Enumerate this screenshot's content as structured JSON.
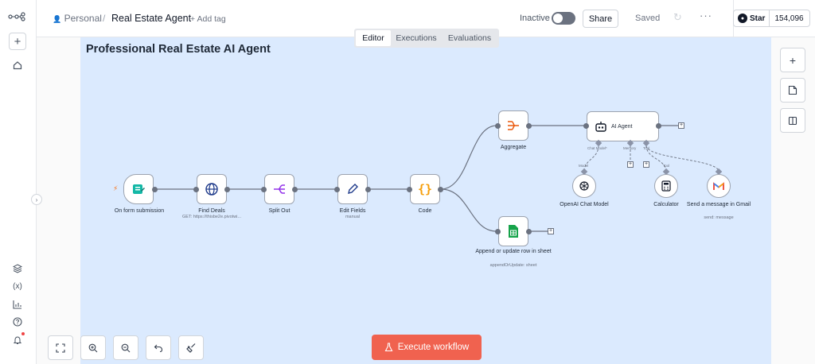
{
  "header": {
    "project": "Personal",
    "separator": "/",
    "workflow_name": "Real Estate Agent",
    "add_tag": "+ Add tag",
    "status": "Inactive",
    "share_label": "Share",
    "saved_label": "Saved",
    "more_label": "···",
    "github_star_label": "Star",
    "github_star_count": "154,096"
  },
  "tabs": [
    {
      "label": "Editor",
      "active": true
    },
    {
      "label": "Executions",
      "active": false
    },
    {
      "label": "Evaluations",
      "active": false
    }
  ],
  "canvas": {
    "title": "Professional Real Estate AI Agent",
    "nodes": [
      {
        "id": "form",
        "label": "On form submission",
        "subtitle": ""
      },
      {
        "id": "find",
        "label": "Find Deals",
        "subtitle": "GET: https://thisbe2e.pivotwi..."
      },
      {
        "id": "split",
        "label": "Split Out",
        "subtitle": ""
      },
      {
        "id": "edit",
        "label": "Edit Fields",
        "subtitle": "manual"
      },
      {
        "id": "code",
        "label": "Code",
        "subtitle": ""
      },
      {
        "id": "aggregate",
        "label": "Aggregate",
        "subtitle": ""
      },
      {
        "id": "sheets",
        "label": "Append or update row in sheet",
        "subtitle": "appendOrUpdate: sheet"
      },
      {
        "id": "agent",
        "label": "AI Agent",
        "subtitle": ""
      },
      {
        "id": "openai",
        "label": "OpenAI Chat Model",
        "subtitle": ""
      },
      {
        "id": "calc",
        "label": "Calculator",
        "subtitle": ""
      },
      {
        "id": "gmail",
        "label": "Send a message in Gmail",
        "subtitle": "send: message"
      }
    ],
    "agent_ports": {
      "chat_model": "Chat Model*",
      "memory": "Memory",
      "tool": "Tool"
    },
    "sub_port_labels": {
      "openai": "Model",
      "calc": "Tool"
    }
  },
  "toolbar": {
    "execute_label": "Execute workflow"
  },
  "colors": {
    "accent": "#f0624f",
    "sticky": "#dbeafe"
  }
}
